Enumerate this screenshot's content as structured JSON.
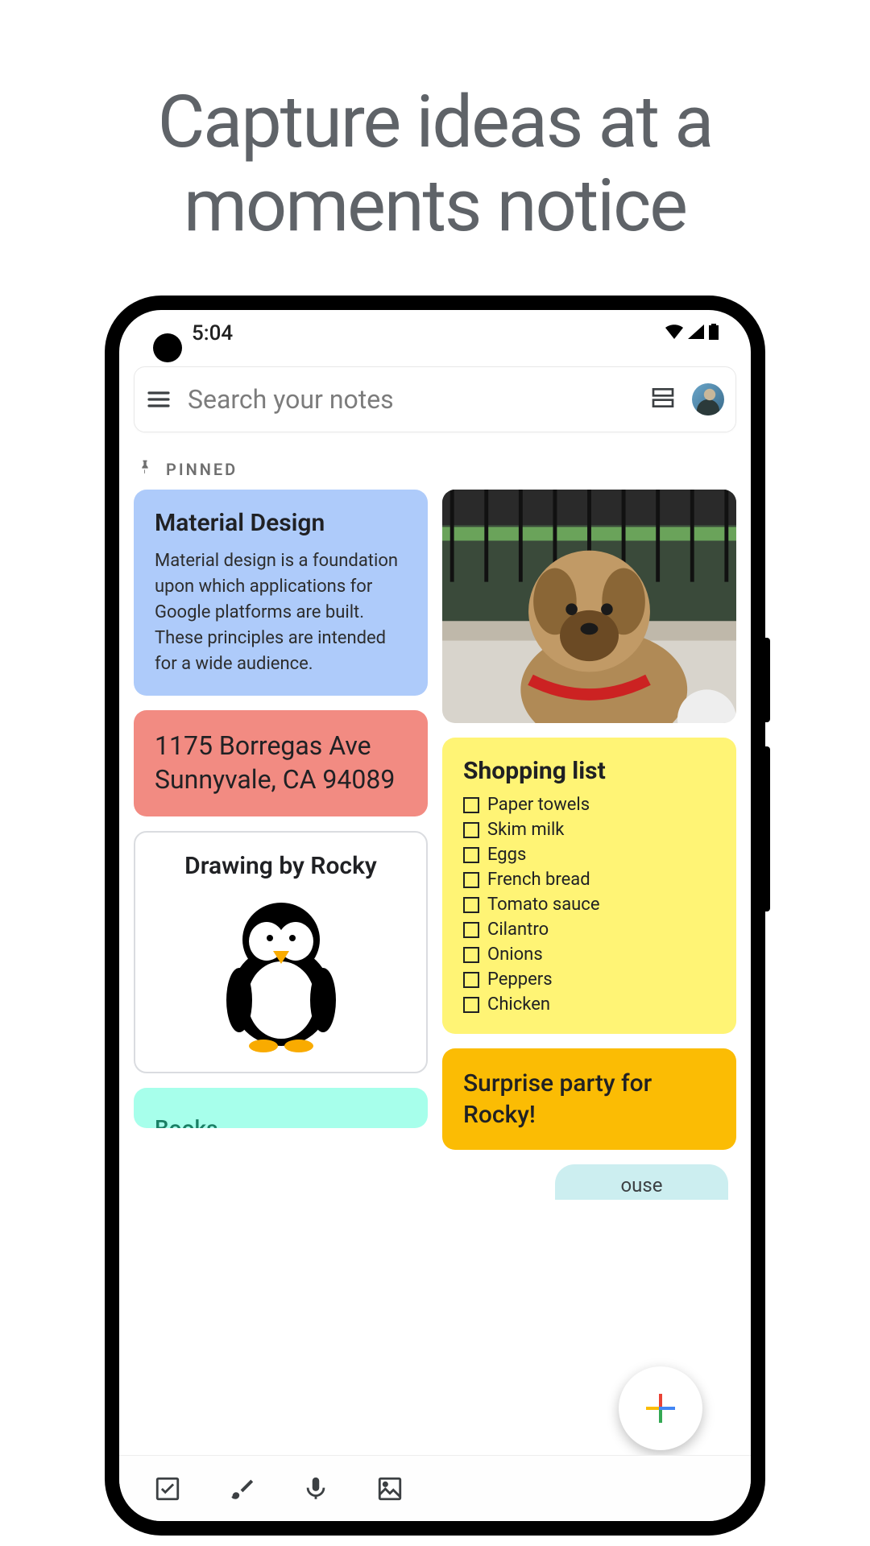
{
  "marketing": {
    "headline_line1": "Capture ideas at a",
    "headline_line2": "moments notice"
  },
  "status": {
    "time": "5:04"
  },
  "search": {
    "placeholder": "Search your notes"
  },
  "section": {
    "pinned": "PINNED"
  },
  "notes": {
    "material": {
      "title": "Material Design",
      "body": "Material design is a foundation upon which applications for Google platforms are built. These principles are intended for a wide audience."
    },
    "address": {
      "text": "1175 Borregas Ave Sunnyvale, CA 94089"
    },
    "drawing": {
      "title": "Drawing by Rocky"
    },
    "books_partial": {
      "text": "Books"
    },
    "shopping": {
      "title": "Shopping list",
      "items": [
        "Paper towels",
        "Skim milk",
        "Eggs",
        "French bread",
        "Tomato sauce",
        "Cilantro",
        "Onions",
        "Peppers",
        "Chicken"
      ]
    },
    "party": {
      "text": "Surprise party for Rocky!"
    },
    "pill_fragment": "ouse"
  },
  "colors": {
    "blue": "#aecbfa",
    "pink": "#f28b82",
    "yellow": "#fff475",
    "orange": "#fbbc04",
    "teal": "#a7ffeb"
  },
  "icons": {
    "menu": "menu-icon",
    "layout": "layout-icon",
    "pin": "pin-icon",
    "checkbox_tool": "checkbox-icon",
    "brush_tool": "brush-icon",
    "mic_tool": "microphone-icon",
    "image_tool": "image-icon",
    "fab": "plus-icon",
    "wifi": "wifi-icon",
    "signal": "signal-icon",
    "battery": "battery-icon"
  }
}
